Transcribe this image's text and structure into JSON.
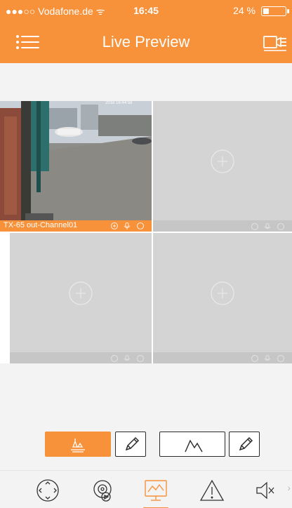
{
  "status_bar": {
    "carrier": "●●●○○ Vodafone.de ᯤ",
    "time": "16:45",
    "battery": "24 %"
  },
  "header": {
    "title": "Live Preview",
    "menu_icon": "menu-icon",
    "camera_list_icon": "camera-list-icon"
  },
  "grid": {
    "channels": [
      {
        "label": "TX-65 out-Channel01",
        "state": "playing",
        "overlay_timestamp": "2018 16:44:59"
      },
      {
        "label": "",
        "state": "empty"
      },
      {
        "label": "",
        "state": "empty"
      },
      {
        "label": "",
        "state": "empty"
      }
    ],
    "bar_icons": [
      "zoom-icon",
      "microphone-icon",
      "record-icon"
    ],
    "add_icon": "add-circle-icon"
  },
  "presets": [
    {
      "icon": "view-group-icon",
      "selected": true
    },
    {
      "icon": "mountain-icon",
      "selected": false
    }
  ],
  "tabbar": {
    "items": [
      "ptz-icon",
      "playback-icon",
      "live-preview-icon",
      "alarm-icon",
      "audio-mute-icon"
    ],
    "active": "live-preview-icon",
    "more": "›"
  },
  "colors": {
    "accent": "#f7913a",
    "empty_cell": "#d4d4d4",
    "empty_bar": "#c6c6c6"
  }
}
